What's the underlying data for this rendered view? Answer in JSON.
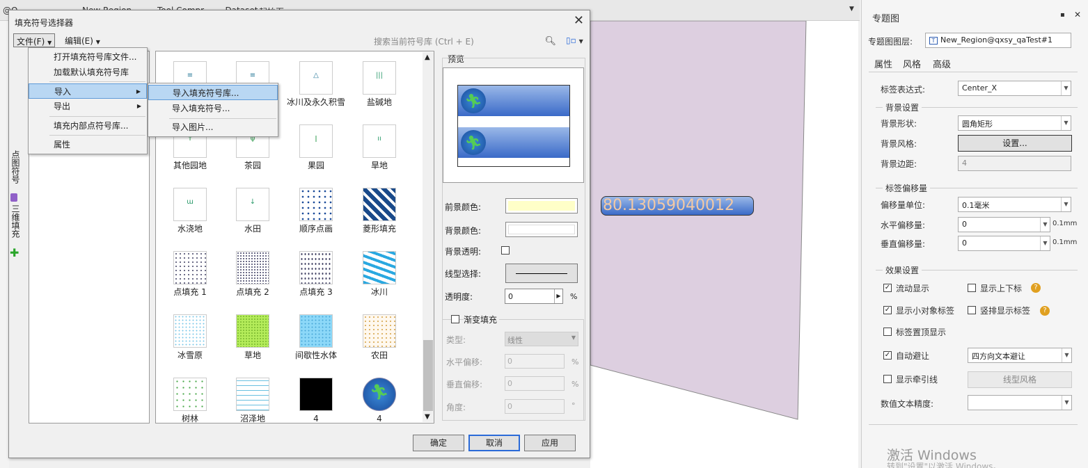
{
  "bg": {
    "top_tabs": [
      "@Q...",
      "New Region",
      "Tool.Compr...",
      "...Dataset...",
      "起始页"
    ],
    "label_value": "80.13059040012"
  },
  "dialog": {
    "title": "填充符号选择器",
    "menu_file": "文件(F)",
    "menu_edit": "编辑(E)",
    "search_placeholder": "搜索当前符号库 (Ctrl + E)",
    "symbols": [
      {
        "label": "",
        "kind": "lines"
      },
      {
        "label": "",
        "kind": "lines2"
      },
      {
        "label": "冰川及永久积雪",
        "kind": "tri"
      },
      {
        "label": "盐碱地",
        "kind": "bars"
      },
      {
        "label": "其他园地",
        "kind": "tree"
      },
      {
        "label": "茶园",
        "kind": "tea"
      },
      {
        "label": "果园",
        "kind": "fruit"
      },
      {
        "label": "旱地",
        "kind": "dry"
      },
      {
        "label": "水浇地",
        "kind": "irr"
      },
      {
        "label": "水田",
        "kind": "paddy"
      },
      {
        "label": "顺序点画",
        "kind": "dots"
      },
      {
        "label": "菱形填充",
        "kind": "diamond"
      },
      {
        "label": "点填充 1",
        "kind": "dotfill"
      },
      {
        "label": "点填充 2",
        "kind": "dotfill2"
      },
      {
        "label": "点填充 3",
        "kind": "dotfill3"
      },
      {
        "label": "冰川",
        "kind": "glacier"
      },
      {
        "label": "冰雪原",
        "kind": "snow"
      },
      {
        "label": "草地",
        "kind": "grass"
      },
      {
        "label": "间歇性水体",
        "kind": "water"
      },
      {
        "label": "农田",
        "kind": "farm"
      },
      {
        "label": "树林",
        "kind": "forest"
      },
      {
        "label": "沼泽地",
        "kind": "swamp"
      },
      {
        "label": "4",
        "kind": "black"
      },
      {
        "label": "4",
        "kind": "exit"
      }
    ],
    "preview_title": "预览",
    "fg_color_label": "前景颜色:",
    "bg_color_label": "背景颜色:",
    "bg_transparent_label": "背景透明:",
    "line_type_label": "线型选择:",
    "opacity_label": "透明度:",
    "opacity_value": "0",
    "percent": "%",
    "gradient_label": "渐变填充",
    "type_label": "类型:",
    "type_value": "线性",
    "h_offset_label": "水平偏移:",
    "h_offset_value": "0",
    "v_offset_label": "垂直偏移:",
    "v_offset_value": "0",
    "angle_label": "角度:",
    "angle_value": "0",
    "degree": "°",
    "ok": "确定",
    "cancel": "取消",
    "apply": "应用",
    "colors": {
      "fg": "#ffffc8",
      "bg": "#ffffff"
    }
  },
  "file_menu": {
    "items": [
      "打开填充符号库文件...",
      "加载默认填充符号库",
      "导入",
      "导出",
      "填充内部点符号库...",
      "属性"
    ]
  },
  "import_menu": {
    "items": [
      "导入填充符号库...",
      "导入填充符号...",
      "导入图片..."
    ]
  },
  "side_strip": {
    "label1": "点图符号",
    "label2": "三维填充"
  },
  "right_panel": {
    "title": "专题图",
    "layer_label": "专题图图层:",
    "layer_value": "New_Region@qxsy_qaTest#1",
    "tabs": [
      "属性",
      "风格",
      "高级"
    ],
    "label_expr_label": "标签表达式:",
    "label_expr_value": "Center_X",
    "bg_settings": "背景设置",
    "bg_shape_label": "背景形状:",
    "bg_shape_value": "圆角矩形",
    "bg_style_label": "背景风格:",
    "bg_style_btn": "设置...",
    "bg_margin_label": "背景边距:",
    "bg_margin_value": "4",
    "offset_group": "标签偏移量",
    "offset_unit_label": "偏移量单位:",
    "offset_unit_value": "0.1毫米",
    "h_offset_label": "水平偏移量:",
    "h_offset_value": "0",
    "v_offset_label": "垂直偏移量:",
    "v_offset_value": "0",
    "unit_suffix": "0.1mm",
    "effect_group": "效果设置",
    "flow_display": "流动显示",
    "show_subsup": "显示上下标",
    "show_small": "显示小对象标签",
    "vertical_label": "竖排显示标签",
    "label_top": "标签置顶显示",
    "auto_avoid": "自动避让",
    "avoid_mode": "四方向文本避让",
    "show_leader": "显示牵引线",
    "line_style_btn": "线型风格",
    "precision_label": "数值文本精度:",
    "precision_value": "",
    "watermark": "激活 Windows",
    "watermark2": "转到\"设置\"以激活 Windows。"
  }
}
